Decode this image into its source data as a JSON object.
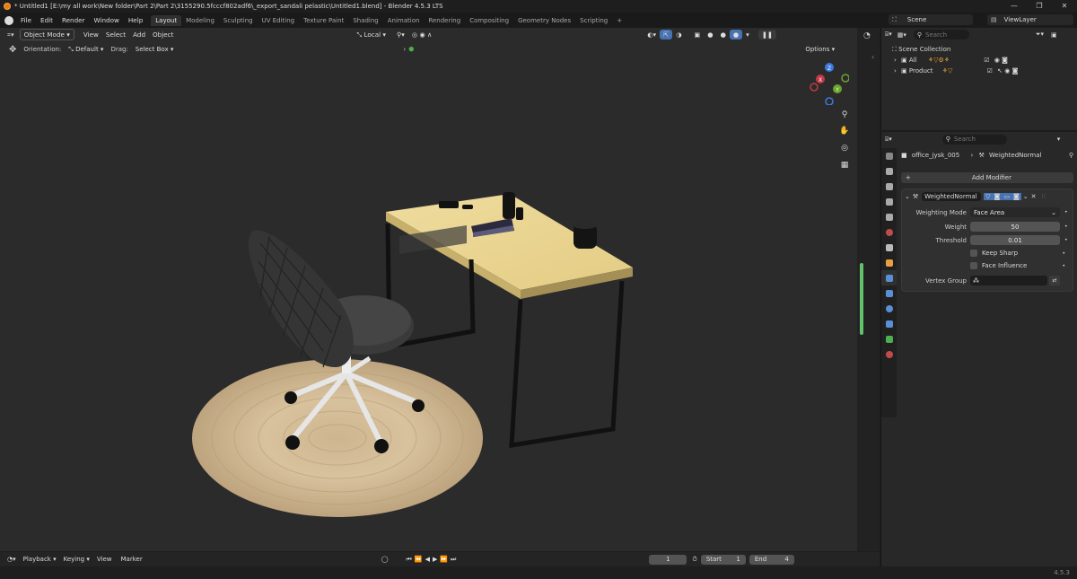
{
  "window": {
    "title": "* Untitled1 [E:\\my all work\\New folder\\Part 2\\Part 2\\3155290.5fcccf802adf6\\_export_sandali pelastic\\Untitled1.blend] - Blender 4.5.3 LTS",
    "min": "—",
    "max": "❐",
    "close": "✕"
  },
  "menu": [
    "File",
    "Edit",
    "Render",
    "Window",
    "Help"
  ],
  "workspaces": [
    "Layout",
    "Modeling",
    "Sculpting",
    "UV Editing",
    "Texture Paint",
    "Shading",
    "Animation",
    "Rendering",
    "Compositing",
    "Geometry Nodes",
    "Scripting"
  ],
  "workspace_add": "+",
  "scene": {
    "name": "Scene",
    "viewlayer": "ViewLayer"
  },
  "viewport": {
    "mode": "Object Mode",
    "menus": [
      "View",
      "Select",
      "Add",
      "Object"
    ],
    "pivot": "Local",
    "orientation_label": "Orientation:",
    "orientation_value": "Default",
    "drag_label": "Drag:",
    "drag_value": "Select Box",
    "options": "Options",
    "gizmo": {
      "x": "X",
      "y": "Y",
      "z": "Z"
    }
  },
  "outliner": {
    "search_placeholder": "Search",
    "root": "Scene Collection",
    "items": [
      {
        "label": "All"
      },
      {
        "label": "Product"
      }
    ]
  },
  "properties": {
    "search_placeholder": "Search",
    "breadcrumb_object": "office_jysk_005",
    "breadcrumb_modifier": "WeightedNormal",
    "add_modifier": "Add Modifier",
    "modifier": {
      "name": "WeightedNormal",
      "weighting_mode_label": "Weighting Mode",
      "weighting_mode_value": "Face Area",
      "weight_label": "Weight",
      "weight_value": "50",
      "threshold_label": "Threshold",
      "threshold_value": "0.01",
      "keep_sharp": "Keep Sharp",
      "keep_sharp_checked": false,
      "face_influence": "Face Influence",
      "face_influence_checked": false,
      "vertex_group_label": "Vertex Group",
      "vertex_group_value": ""
    }
  },
  "timeline": {
    "menus": [
      "Playback",
      "Keying",
      "View",
      "Marker"
    ],
    "current_frame": "1",
    "start_label": "Start",
    "start": "1",
    "end_label": "End",
    "end": "4"
  },
  "status": {
    "version": "4.5.3"
  },
  "colors": {
    "accent": "#4772b3",
    "active_orange": "#e87d0d",
    "viewport_bg": "#2b2b2b",
    "panel": "#282828"
  }
}
